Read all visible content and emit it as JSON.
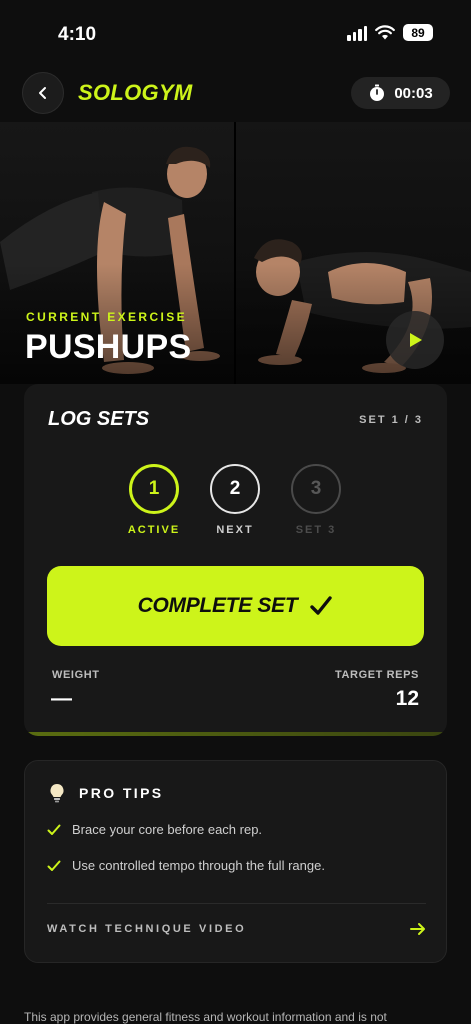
{
  "status_bar": {
    "time": "4:10",
    "battery": "89"
  },
  "header": {
    "brand": "SOLOGYM",
    "timer": "00:03"
  },
  "hero": {
    "label": "CURRENT EXERCISE",
    "title": "PUSHUPS"
  },
  "log_sets": {
    "title": "LOG SETS",
    "set_count": "SET 1 / 3",
    "steps": [
      {
        "number": "1",
        "label": "ACTIVE"
      },
      {
        "number": "2",
        "label": "NEXT"
      },
      {
        "number": "3",
        "label": "SET 3"
      }
    ],
    "complete_label": "COMPLETE SET",
    "weight_label": "WEIGHT",
    "weight_value": "—",
    "reps_label": "TARGET REPS",
    "reps_value": "12"
  },
  "pro_tips": {
    "title": "PRO TIPS",
    "tips": [
      "Brace your core before each rep.",
      "Use controlled tempo through the full range."
    ],
    "watch_label": "WATCH TECHNIQUE VIDEO"
  },
  "disclaimer": "This app provides general fitness and workout information and is not",
  "colors": {
    "accent": "#cdf41a",
    "background": "#0e0e0e",
    "card": "#181818"
  },
  "icons": {
    "back": "chevron-left-icon",
    "timer": "stopwatch-icon",
    "play": "play-icon",
    "tips": "lightbulb-icon",
    "check": "check-icon",
    "arrow": "arrow-right-icon"
  }
}
